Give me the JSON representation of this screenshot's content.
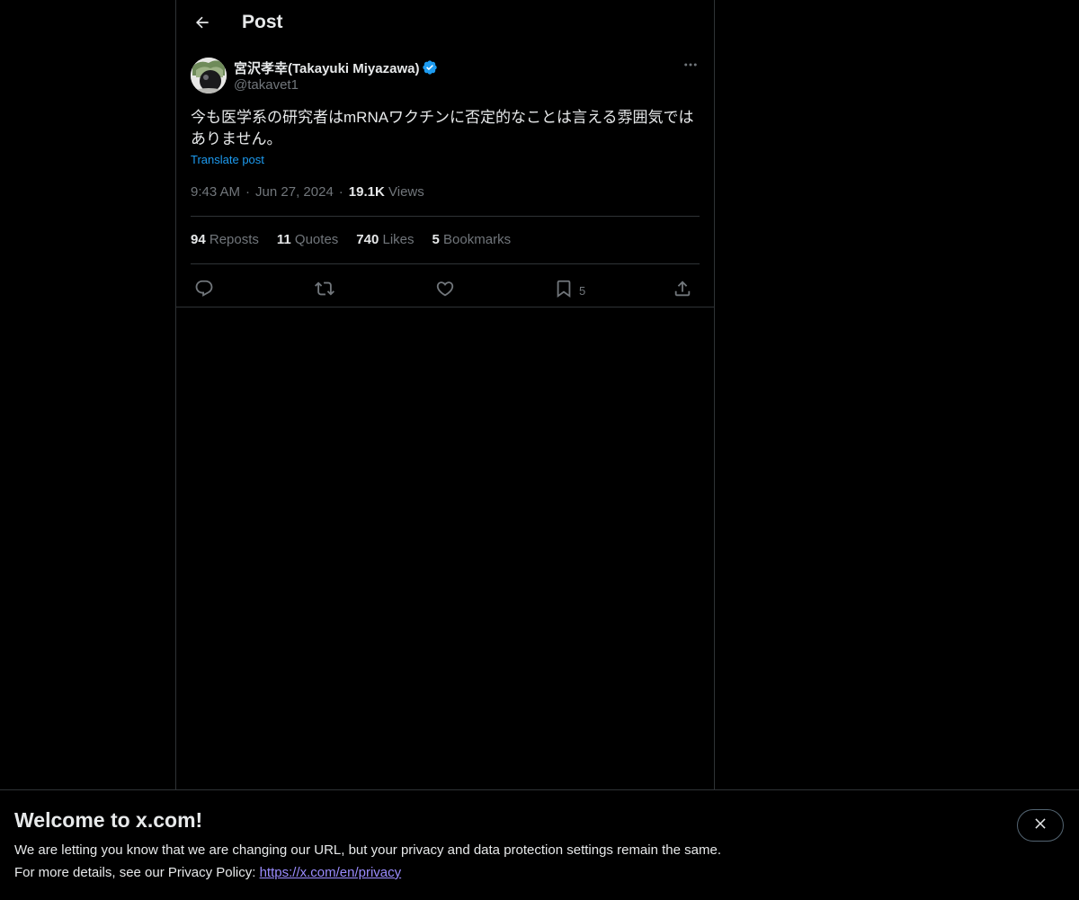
{
  "header": {
    "title": "Post",
    "back_icon": "arrow-left-icon"
  },
  "post": {
    "author_name": "宮沢孝幸(Takayuki Miyazawa)",
    "author_handle": "@takavet1",
    "verified": true,
    "text": "今も医学系の研究者はmRNAワクチンに否定的なことは言える雰囲気ではありません。",
    "translate_label": "Translate post",
    "time": "9:43 AM",
    "date": "Jun 27, 2024",
    "views_count": "19.1K",
    "views_label": "Views",
    "stats": [
      {
        "count": "94",
        "label": "Reposts"
      },
      {
        "count": "11",
        "label": "Quotes"
      },
      {
        "count": "740",
        "label": "Likes"
      },
      {
        "count": "5",
        "label": "Bookmarks"
      }
    ],
    "actions": {
      "reply_icon": "reply-icon",
      "repost_icon": "repost-icon",
      "like_icon": "heart-icon",
      "bookmark_icon": "bookmark-icon",
      "bookmark_count": "5",
      "share_icon": "share-icon"
    }
  },
  "banner": {
    "title": "Welcome to x.com!",
    "line1": "We are letting you know that we are changing our URL, but your privacy and data protection settings remain the same.",
    "line2_prefix": "For more details, see our Privacy Policy: ",
    "link": "https://x.com/en/privacy",
    "close_icon": "close-icon"
  },
  "colors": {
    "background": "#000000",
    "text": "#e7e9ea",
    "muted": "#71767b",
    "accent": "#1d9bf0",
    "border": "#2f3336",
    "link": "#9b8cff"
  }
}
